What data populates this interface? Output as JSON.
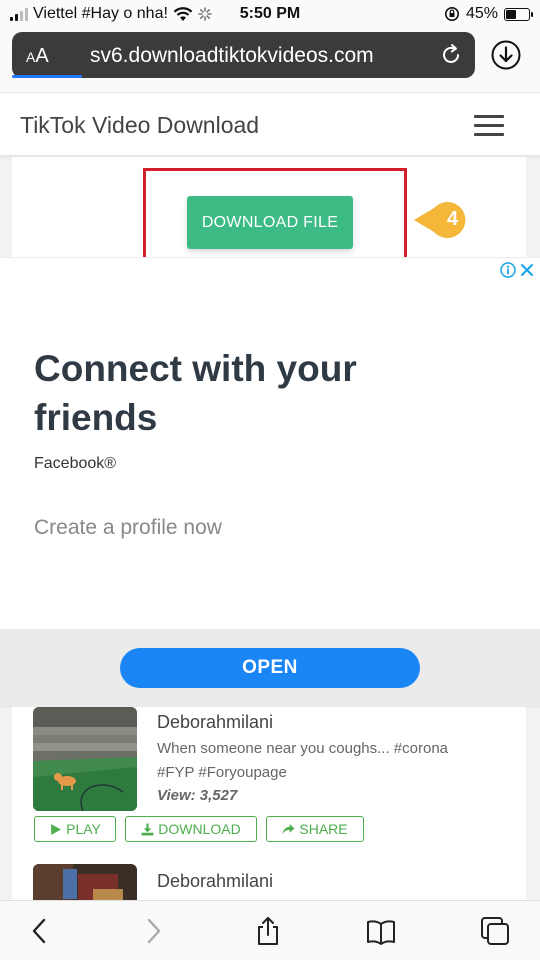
{
  "status_bar": {
    "carrier": "Viettel #Hay o nha!",
    "time": "5:50 PM",
    "battery": "45%",
    "battery_level": 0.45
  },
  "browser": {
    "text_size_label_small": "A",
    "text_size_label_large": "A",
    "url": "sv6.downloadtiktokvideos.com"
  },
  "site": {
    "title": "TikTok Video Download"
  },
  "download": {
    "button_label": "DOWNLOAD FILE",
    "callout_number": "4",
    "accent_color": "#3dbb85",
    "highlight_color": "#d2202a",
    "callout_color": "#f4b73a"
  },
  "ad": {
    "headline": "Connect with your friends",
    "brand": "Facebook®",
    "cta_text": "Create a profile now",
    "open_label": "OPEN",
    "open_color": "#1a86f5"
  },
  "results": {
    "items": [
      {
        "author": "Deborahmilani",
        "desc_line1": "When someone near you coughs... #corona",
        "desc_line2": "#FYP #Foryoupage",
        "views": "View: 3,527",
        "play_label": "PLAY",
        "download_label": "DOWNLOAD",
        "share_label": "SHARE"
      },
      {
        "author": "Deborahmilani"
      }
    ]
  }
}
